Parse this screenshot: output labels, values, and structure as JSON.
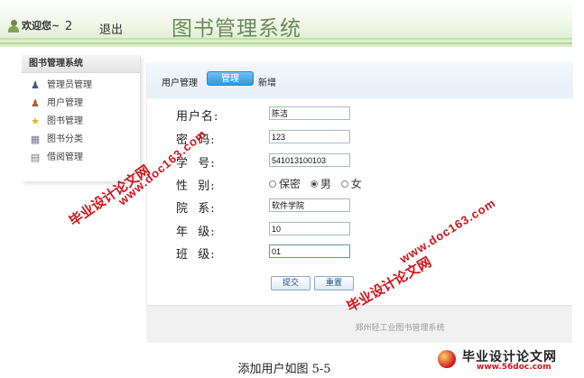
{
  "header": {
    "welcome": "欢迎您~",
    "count": "2",
    "logout": "退出",
    "title": "图书管理系统"
  },
  "sidebar": {
    "title": "图书管理系统",
    "items": [
      {
        "label": "管理员管理",
        "icon": "admin-user-icon"
      },
      {
        "label": "用户管理",
        "icon": "user-icon"
      },
      {
        "label": "图书管理",
        "icon": "star-icon"
      },
      {
        "label": "图书分类",
        "icon": "category-icon"
      },
      {
        "label": "借阅管理",
        "icon": "borrow-icon"
      }
    ]
  },
  "tabs": {
    "section_label": "用户管理",
    "active": "管理",
    "new": "新增"
  },
  "form": {
    "username_label": "用户名:",
    "username_value": "陈洁",
    "password_label": "密  码:",
    "password_value": "123",
    "student_no_label": "学  号:",
    "student_no_value": "541013100103",
    "gender_label": "性  别:",
    "gender_options": [
      "保密",
      "男",
      "女"
    ],
    "gender_selected": "男",
    "department_label": "院  系:",
    "department_value": "软件学院",
    "grade_label": "年  级:",
    "grade_value": "10",
    "class_label": "班  级:",
    "class_value": "01"
  },
  "buttons": {
    "submit": "提交",
    "reset": "重置"
  },
  "footer": {
    "text": "郑州轻工业图书管理系统"
  },
  "caption": "添加用户如图 5-5",
  "watermark": {
    "cn": "毕业设计论文网",
    "url": "www.doc163.com",
    "logo_cn": "毕业设计论文网",
    "logo_url": "www.56doc.com",
    "color": "#d0141a"
  },
  "colors": {
    "header_green": "#d7ebc7",
    "title_green": "#6a8a5a",
    "active_tab_blue": "#2f98df"
  }
}
